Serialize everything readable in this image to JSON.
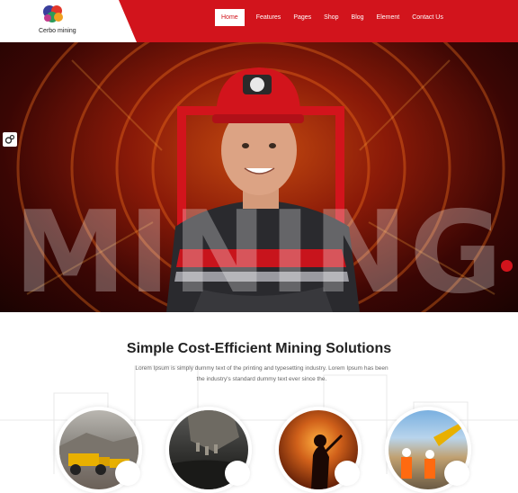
{
  "brand": {
    "name": "Cerbo mining",
    "logo_icon": "leaf-logo-icon"
  },
  "nav": {
    "items": [
      {
        "label": "Home",
        "active": true
      },
      {
        "label": "Features"
      },
      {
        "label": "Pages"
      },
      {
        "label": "Shop"
      },
      {
        "label": "Blog"
      },
      {
        "label": "Element"
      },
      {
        "label": "Contact Us"
      }
    ]
  },
  "hero": {
    "background_word": "MINING",
    "settings_icon": "gears-icon"
  },
  "intro": {
    "title": "Simple Cost-Efficient Mining Solutions",
    "text": "Lorem Ipsum is simply dummy text of the printing and typesetting industry. Lorem Ipsum has been the industry's standard dummy text ever since the."
  },
  "services": [
    {
      "image": "dump-truck-image"
    },
    {
      "image": "excavator-bucket-image"
    },
    {
      "image": "miner-tunnel-image"
    },
    {
      "image": "workers-site-image"
    }
  ],
  "colors": {
    "accent": "#d2141c",
    "text_dark": "#222222",
    "text_muted": "#666666"
  }
}
